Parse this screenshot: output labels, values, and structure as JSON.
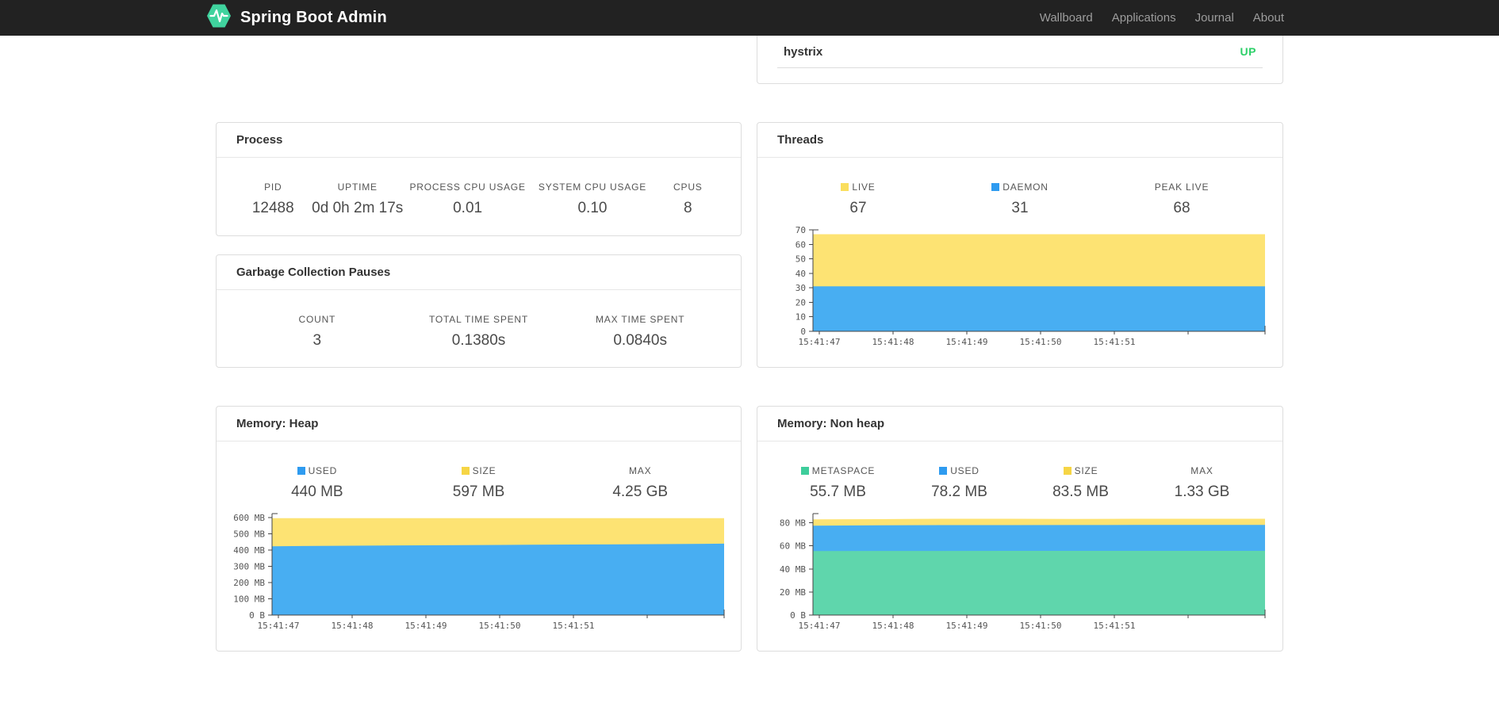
{
  "navbar": {
    "brand": "Spring Boot Admin",
    "links": [
      {
        "label": "Wallboard"
      },
      {
        "label": "Applications"
      },
      {
        "label": "Journal"
      },
      {
        "label": "About"
      }
    ]
  },
  "application": {
    "name": "hystrix",
    "status": "UP",
    "status_color": "#2dd069"
  },
  "process": {
    "title": "Process",
    "stats": [
      {
        "label": "PID",
        "value": "12488"
      },
      {
        "label": "UPTIME",
        "value": "0d 0h 2m 17s"
      },
      {
        "label": "PROCESS CPU USAGE",
        "value": "0.01"
      },
      {
        "label": "SYSTEM CPU USAGE",
        "value": "0.10"
      },
      {
        "label": "CPUS",
        "value": "8"
      }
    ]
  },
  "gc": {
    "title": "Garbage Collection Pauses",
    "stats": [
      {
        "label": "COUNT",
        "value": "3"
      },
      {
        "label": "TOTAL TIME SPENT",
        "value": "0.1380s"
      },
      {
        "label": "MAX TIME SPENT",
        "value": "0.0840s"
      }
    ]
  },
  "threads": {
    "title": "Threads",
    "stats": [
      {
        "label": "LIVE",
        "value": "67",
        "swatch": "#fade5d"
      },
      {
        "label": "DAEMON",
        "value": "31",
        "swatch": "#2e9bf0"
      },
      {
        "label": "PEAK LIVE",
        "value": "68",
        "swatch": null
      }
    ]
  },
  "memory_heap": {
    "title": "Memory: Heap",
    "stats": [
      {
        "label": "USED",
        "value": "440 MB",
        "swatch": "#2e9bf0"
      },
      {
        "label": "SIZE",
        "value": "597 MB",
        "swatch": "#f6d545"
      },
      {
        "label": "MAX",
        "value": "4.25 GB",
        "swatch": null
      }
    ]
  },
  "memory_nonheap": {
    "title": "Memory: Non heap",
    "stats": [
      {
        "label": "METASPACE",
        "value": "55.7 MB",
        "swatch": "#3ecd9b"
      },
      {
        "label": "USED",
        "value": "78.2 MB",
        "swatch": "#2e9bf0"
      },
      {
        "label": "SIZE",
        "value": "83.5 MB",
        "swatch": "#f6d545"
      },
      {
        "label": "MAX",
        "value": "1.33 GB",
        "swatch": null
      }
    ]
  },
  "chart_data": [
    {
      "id": "threads-chart",
      "title": "Threads",
      "type": "area",
      "stacked": true,
      "legend_position": "top",
      "grid": false,
      "x_labels": [
        "15:41:47",
        "15:41:48",
        "15:41:49",
        "15:41:50",
        "15:41:51"
      ],
      "ylim": [
        0,
        70
      ],
      "y_ticks": [
        {
          "value": 0,
          "label": "0"
        },
        {
          "value": 10,
          "label": "10"
        },
        {
          "value": 20,
          "label": "20"
        },
        {
          "value": 30,
          "label": "30"
        },
        {
          "value": 40,
          "label": "40"
        },
        {
          "value": 50,
          "label": "50"
        },
        {
          "value": 60,
          "label": "60"
        },
        {
          "value": 70,
          "label": "70"
        }
      ],
      "series": [
        {
          "name": "daemon",
          "color": "#48aef2",
          "values": [
            31,
            31,
            31,
            31,
            31,
            31,
            31,
            31
          ]
        },
        {
          "name": "live",
          "color": "#fde373",
          "values": [
            67,
            67,
            67,
            67,
            67,
            67,
            67,
            67
          ]
        }
      ]
    },
    {
      "id": "heap-chart",
      "title": "Memory: Heap",
      "type": "area",
      "stacked": true,
      "grid": false,
      "x_labels": [
        "15:41:47",
        "15:41:48",
        "15:41:49",
        "15:41:50",
        "15:41:51"
      ],
      "ylim": [
        0,
        625
      ],
      "y_ticks": [
        {
          "value": 0,
          "label": "0 B"
        },
        {
          "value": 100,
          "label": "100 MB"
        },
        {
          "value": 200,
          "label": "200 MB"
        },
        {
          "value": 300,
          "label": "300 MB"
        },
        {
          "value": 400,
          "label": "400 MB"
        },
        {
          "value": 500,
          "label": "500 MB"
        },
        {
          "value": 600,
          "label": "600 MB"
        }
      ],
      "series": [
        {
          "name": "used",
          "color": "#48aef2",
          "values": [
            424,
            427,
            429,
            431,
            433,
            435,
            437,
            440
          ]
        },
        {
          "name": "size",
          "color": "#fde373",
          "values": [
            597,
            597,
            597,
            597,
            597,
            597,
            597,
            597
          ]
        }
      ]
    },
    {
      "id": "nonheap-chart",
      "title": "Memory: Non heap",
      "type": "area",
      "stacked": true,
      "grid": false,
      "x_labels": [
        "15:41:47",
        "15:41:48",
        "15:41:49",
        "15:41:50",
        "15:41:51"
      ],
      "ylim": [
        0,
        88
      ],
      "y_ticks": [
        {
          "value": 0,
          "label": "0 B"
        },
        {
          "value": 20,
          "label": "20 MB"
        },
        {
          "value": 40,
          "label": "40 MB"
        },
        {
          "value": 60,
          "label": "60 MB"
        },
        {
          "value": 80,
          "label": "80 MB"
        }
      ],
      "series": [
        {
          "name": "metaspace",
          "color": "#5fd6ac",
          "values": [
            55.5,
            55.6,
            55.6,
            55.7,
            55.7,
            55.7,
            55.7,
            55.7
          ]
        },
        {
          "name": "used",
          "color": "#48aef2",
          "values": [
            77.5,
            77.8,
            78.0,
            78.0,
            78.1,
            78.2,
            78.2,
            78.2
          ]
        },
        {
          "name": "size",
          "color": "#fde373",
          "values": [
            83.0,
            83.2,
            83.5,
            83.5,
            83.4,
            83.5,
            83.5,
            83.5
          ]
        }
      ]
    }
  ]
}
